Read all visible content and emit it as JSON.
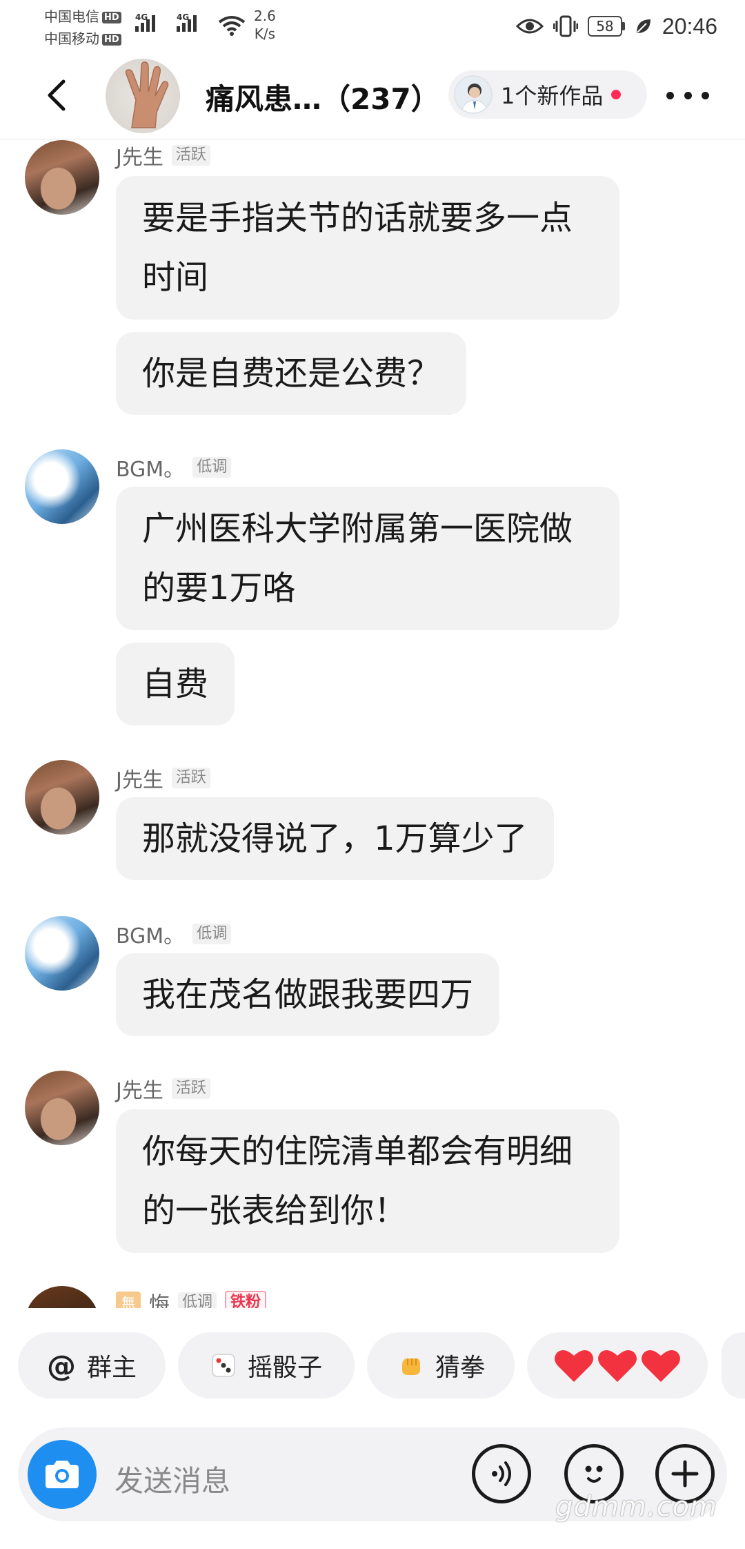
{
  "status_bar": {
    "carrier_1": "中国电信",
    "carrier_2": "中国移动",
    "hd_label": "HD",
    "net_type": "4G",
    "speed_value": "2.6",
    "speed_unit": "K/s",
    "battery": "58",
    "time": "20:46"
  },
  "header": {
    "title": "痛风患…（237）",
    "new_works": "1个新作品"
  },
  "messages": [
    {
      "sender": "J先生",
      "badge": "活跃",
      "bubbles": [
        "要是手指关节的话就要多一点时间",
        "你是自费还是公费？"
      ]
    },
    {
      "sender": "BGM。",
      "badge": "低调",
      "bubbles": [
        "广州医科大学附属第一医院做的要1万咯",
        "自费"
      ]
    },
    {
      "sender": "J先生",
      "badge": "活跃",
      "bubbles": [
        "那就没得说了，1万算少了"
      ]
    },
    {
      "sender": "BGM。",
      "badge": "低调",
      "bubbles": [
        "我在茂名做跟我要四万"
      ]
    },
    {
      "sender": "J先生",
      "badge": "活跃",
      "bubbles": [
        "你每天的住院清单都会有明细的一张表给到你！"
      ]
    },
    {
      "sender": "悔",
      "badge": "低调",
      "badge2": "铁粉",
      "name_icon": "無",
      "bubbles": []
    }
  ],
  "quick_actions": [
    {
      "label": "群主",
      "icon": "at-icon",
      "symbol": "@"
    },
    {
      "label": "摇骰子",
      "icon": "dice-icon"
    },
    {
      "label": "猜拳",
      "icon": "fist-icon"
    },
    {
      "label": "",
      "icon": "hearts-icon"
    }
  ],
  "input": {
    "placeholder": "发送消息"
  },
  "watermark": "gdmm.com",
  "colors": {
    "accent_blue": "#1e8ff0",
    "notification_red": "#fe2c55",
    "bubble_bg": "#f2f2f2",
    "fan_badge_red": "#e8384f"
  }
}
